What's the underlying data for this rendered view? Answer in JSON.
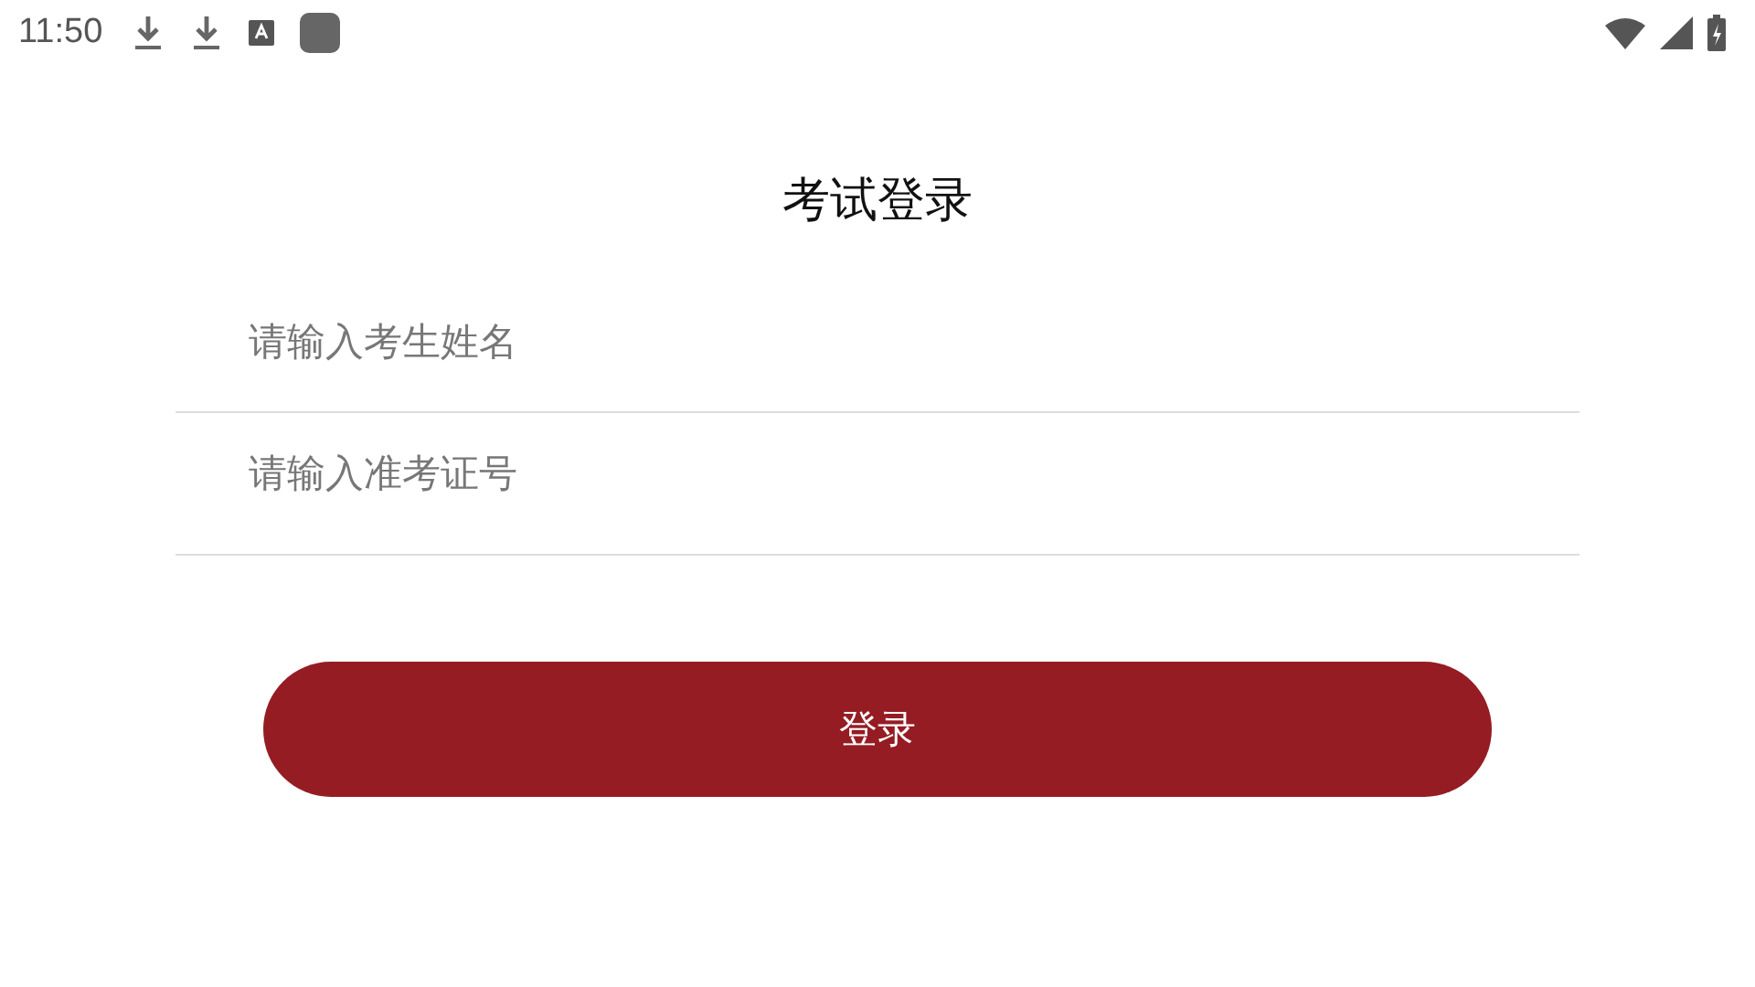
{
  "status_bar": {
    "time": "11:50"
  },
  "title": "考试登录",
  "fields": [
    {
      "placeholder": "请输入考生姓名"
    },
    {
      "placeholder": "请输入准考证号"
    }
  ],
  "login_button": "登录"
}
